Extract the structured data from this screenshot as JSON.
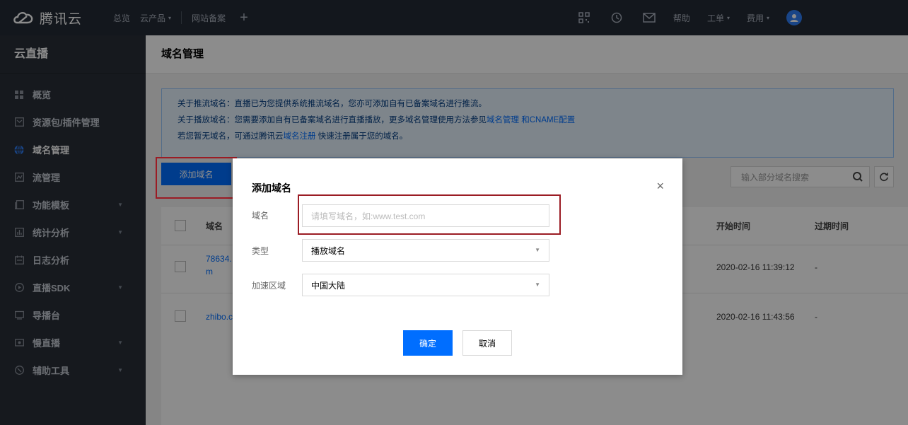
{
  "topbar": {
    "brand": "腾讯云",
    "nav": [
      {
        "label": "总览",
        "caret": false
      },
      {
        "label": "云产品",
        "caret": true
      },
      {
        "label": "网站备案",
        "caret": false
      }
    ],
    "plus": "+",
    "right_links": [
      {
        "label": "帮助",
        "caret": false
      },
      {
        "label": "工单",
        "caret": true
      },
      {
        "label": "费用",
        "caret": true
      }
    ]
  },
  "sidebar": {
    "title": "云直播",
    "items": [
      {
        "label": "概览",
        "icon": "grid-icon",
        "arrow": false,
        "active": false
      },
      {
        "label": "资源包/插件管理",
        "icon": "package-icon",
        "arrow": false,
        "active": false
      },
      {
        "label": "域名管理",
        "icon": "globe-icon",
        "arrow": false,
        "active": true
      },
      {
        "label": "流管理",
        "icon": "stream-icon",
        "arrow": false,
        "active": false
      },
      {
        "label": "功能模板",
        "icon": "template-icon",
        "arrow": true,
        "active": false
      },
      {
        "label": "统计分析",
        "icon": "stats-icon",
        "arrow": true,
        "active": false
      },
      {
        "label": "日志分析",
        "icon": "log-icon",
        "arrow": false,
        "active": false
      },
      {
        "label": "直播SDK",
        "icon": "play-icon",
        "arrow": true,
        "active": false
      },
      {
        "label": "导播台",
        "icon": "director-icon",
        "arrow": false,
        "active": false
      },
      {
        "label": "慢直播",
        "icon": "camera-icon",
        "arrow": true,
        "active": false
      },
      {
        "label": "辅助工具",
        "icon": "tool-icon",
        "arrow": true,
        "active": false
      }
    ]
  },
  "main": {
    "title": "域名管理",
    "notice": {
      "line1": "关于推流域名：直播已为您提供系统推流域名，您亦可添加自有已备案域名进行推流。",
      "line2_prefix": "关于播放域名：您需要添加自有已备案域名进行直播播放，更多域名管理使用方法参见",
      "line2_link1": "域名管理",
      "line2_link2": "和CNAME配置",
      "line3_prefix": "若您暂无域名，可通过腾讯云",
      "line3_link": "域名注册",
      "line3_suffix": " 快速注册属于您的域名。"
    },
    "add_button": "添加域名",
    "search_placeholder": "输入部分域名搜索",
    "table": {
      "headers": {
        "domain": "域名",
        "start_time": "开始时间",
        "expire_time": "过期时间"
      },
      "rows": [
        {
          "domain_line1": "78634.",
          "domain_line2": "m",
          "start_time": "2020-02-16 11:39:12",
          "expire_time": "-"
        },
        {
          "domain_line1": "zhibo.c",
          "domain_line2": "",
          "start_time": "2020-02-16 11:43:56",
          "expire_time": "-"
        }
      ]
    }
  },
  "dialog": {
    "title": "添加域名",
    "close": "×",
    "fields": {
      "domain_label": "域名",
      "domain_placeholder": "请填写域名，如:www.test.com",
      "type_label": "类型",
      "type_value": "播放域名",
      "region_label": "加速区域",
      "region_value": "中国大陆"
    },
    "ok": "确定",
    "cancel": "取消"
  },
  "colors": {
    "accent": "#006eff",
    "highlight_border": "#9b1c24",
    "sidebar_bg": "#292f38",
    "topbar_bg": "#242b36"
  }
}
